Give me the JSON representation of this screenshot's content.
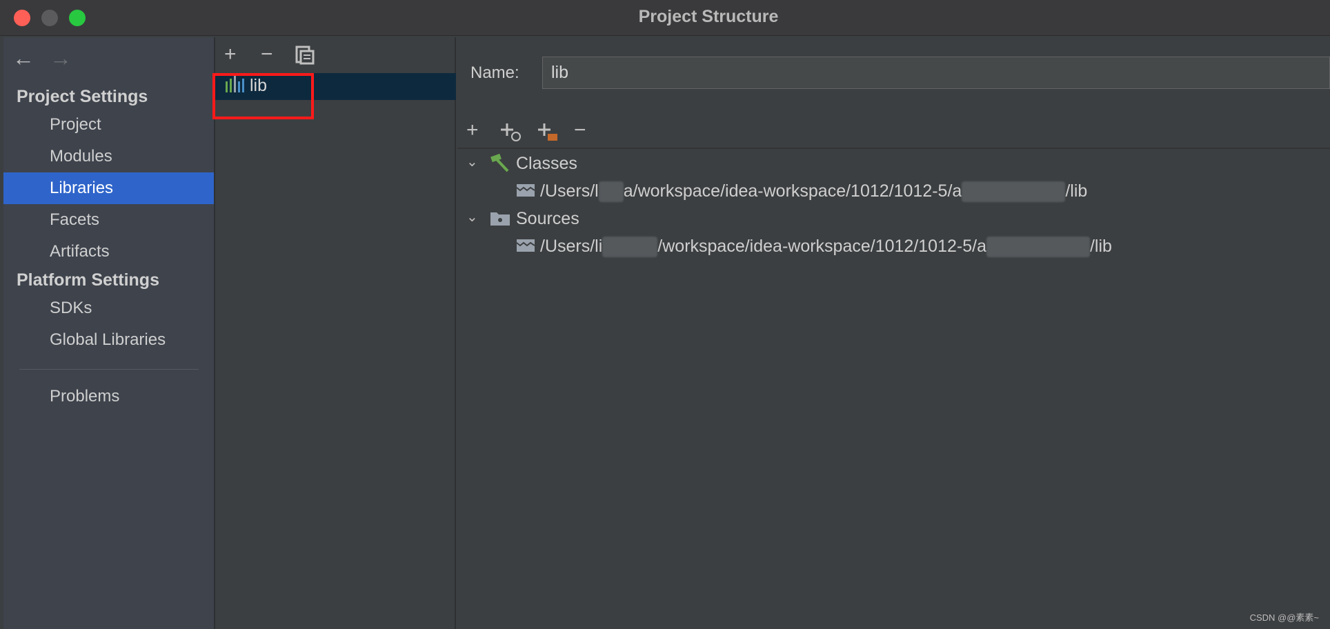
{
  "window": {
    "title": "Project Structure"
  },
  "sidebar": {
    "project_settings_heading": "Project Settings",
    "platform_settings_heading": "Platform Settings",
    "items": [
      {
        "label": "Project"
      },
      {
        "label": "Modules"
      },
      {
        "label": "Libraries",
        "active": true
      },
      {
        "label": "Facets"
      },
      {
        "label": "Artifacts"
      },
      {
        "label": "SDKs"
      },
      {
        "label": "Global Libraries"
      },
      {
        "label": "Problems"
      }
    ]
  },
  "library_list": {
    "items": [
      {
        "label": "lib",
        "selected": true
      }
    ]
  },
  "details": {
    "name_label": "Name:",
    "name_value": "lib",
    "tree": [
      {
        "label": "Classes",
        "icon": "hammer-icon",
        "path_prefix": "/Users/l",
        "path_mid": "a/workspace/idea-workspace/1012/1012-5/a",
        "path_suffix": "/lib"
      },
      {
        "label": "Sources",
        "icon": "source-folder-icon",
        "path_prefix": "/Users/li",
        "path_mid": "/workspace/idea-workspace/1012/1012-5/a",
        "path_suffix": "/lib"
      }
    ]
  },
  "watermark": "CSDN @@素素~",
  "colors": {
    "accent": "#2f65ca",
    "highlight": "#ff1a1a",
    "selected_row": "#0d293e"
  }
}
